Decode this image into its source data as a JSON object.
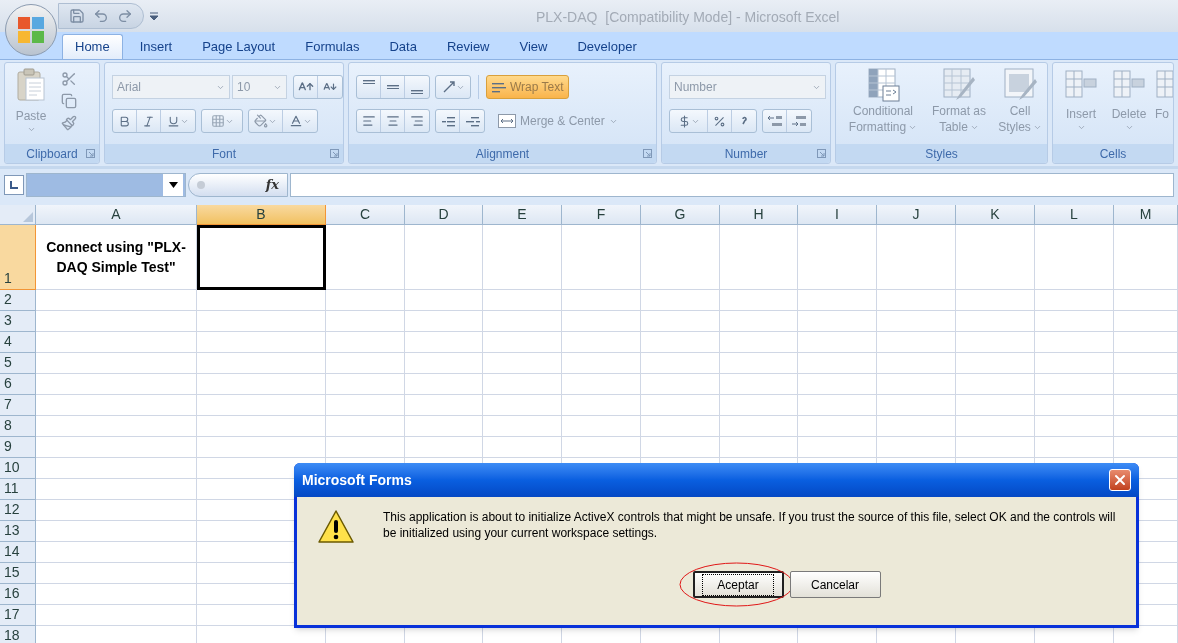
{
  "window": {
    "title": "PLX-DAQ  [Compatibility Mode] - Microsoft Excel"
  },
  "tabs": [
    {
      "label": "Home",
      "selected": true
    },
    {
      "label": "Insert",
      "selected": false
    },
    {
      "label": "Page Layout",
      "selected": false
    },
    {
      "label": "Formulas",
      "selected": false
    },
    {
      "label": "Data",
      "selected": false
    },
    {
      "label": "Review",
      "selected": false
    },
    {
      "label": "View",
      "selected": false
    },
    {
      "label": "Developer",
      "selected": false
    }
  ],
  "ribbon": {
    "groups": [
      {
        "kind": "clipboard",
        "label": "Clipboard",
        "paste_label": "Paste"
      },
      {
        "kind": "font",
        "label": "Font",
        "font_name": "Arial",
        "font_size": "10"
      },
      {
        "kind": "alignment",
        "label": "Alignment",
        "wrap_text": {
          "label": "Wrap Text",
          "on": true
        },
        "merge_label": "Merge & Center"
      },
      {
        "kind": "number",
        "label": "Number",
        "format": "Number"
      },
      {
        "kind": "styles",
        "label": "Styles",
        "buttons": [
          "Conditional Formatting",
          "Format as Table",
          "Cell Styles"
        ]
      },
      {
        "kind": "cells",
        "label": "Cells",
        "buttons": [
          "Insert",
          "Delete",
          "Fo"
        ]
      }
    ]
  },
  "formula_bar": {
    "function_label": "fx"
  },
  "sheet": {
    "columns": [
      {
        "label": "A",
        "selected": false
      },
      {
        "label": "B",
        "selected": true
      },
      {
        "label": "C",
        "selected": false
      },
      {
        "label": "D",
        "selected": false
      },
      {
        "label": "E",
        "selected": false
      },
      {
        "label": "F",
        "selected": false
      },
      {
        "label": "G",
        "selected": false
      },
      {
        "label": "H",
        "selected": false
      },
      {
        "label": "I",
        "selected": false
      },
      {
        "label": "J",
        "selected": false
      },
      {
        "label": "K",
        "selected": false
      },
      {
        "label": "L",
        "selected": false
      },
      {
        "label": "M",
        "selected": false
      }
    ],
    "rows": [
      {
        "label": "1",
        "selected": true,
        "cells": [
          {
            "text": "Connect using \"PLX-DAQ Simple Test\""
          }
        ]
      },
      {
        "label": "2",
        "selected": false
      },
      {
        "label": "3",
        "selected": false
      },
      {
        "label": "4",
        "selected": false
      },
      {
        "label": "5",
        "selected": false
      },
      {
        "label": "6",
        "selected": false
      },
      {
        "label": "7",
        "selected": false
      },
      {
        "label": "8",
        "selected": false
      },
      {
        "label": "9",
        "selected": false
      },
      {
        "label": "10",
        "selected": false
      },
      {
        "label": "11",
        "selected": false
      },
      {
        "label": "12",
        "selected": false
      },
      {
        "label": "13",
        "selected": false
      },
      {
        "label": "14",
        "selected": false
      },
      {
        "label": "15",
        "selected": false
      },
      {
        "label": "16",
        "selected": false
      },
      {
        "label": "17",
        "selected": false
      },
      {
        "label": "18",
        "selected": false
      }
    ]
  },
  "dialog": {
    "title": "Microsoft Forms",
    "message": "This application is about to initialize ActiveX controls that might be unsafe. If you trust the source of this file, select OK and the controls will be initialized using your current workspace settings.",
    "buttons": [
      {
        "label": "Aceptar",
        "default": true,
        "circled": true
      },
      {
        "label": "Cancelar",
        "default": false,
        "circled": false
      }
    ]
  }
}
